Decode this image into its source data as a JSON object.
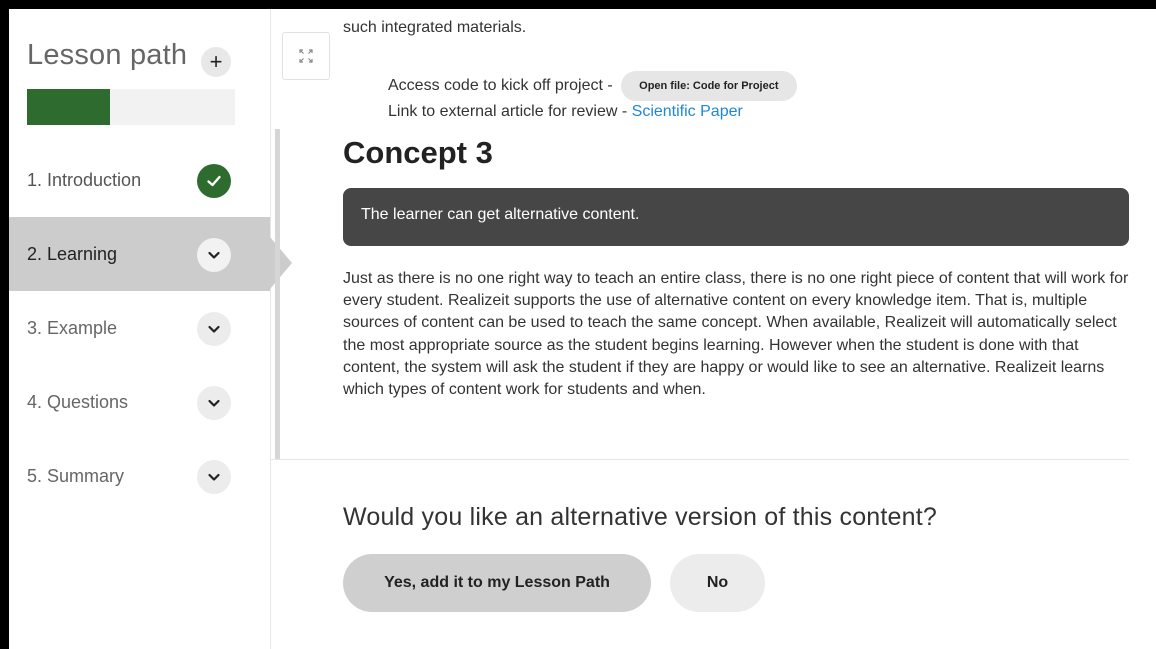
{
  "sidebar": {
    "title": "Lesson path",
    "add_label": "+",
    "progress_fraction": 0.4,
    "steps": [
      {
        "label": "1. Introduction",
        "state": "complete",
        "icon": "check-icon"
      },
      {
        "label": "2. Learning",
        "state": "active",
        "icon": "chevron-down-icon"
      },
      {
        "label": "3. Example",
        "state": "pending",
        "icon": "chevron-down-icon"
      },
      {
        "label": "4. Questions",
        "state": "pending",
        "icon": "chevron-down-icon"
      },
      {
        "label": "5. Summary",
        "state": "pending",
        "icon": "chevron-down-icon"
      }
    ]
  },
  "toolbar": {
    "expand_icon": "expand-icon"
  },
  "content": {
    "intro_text": "such integrated materials.",
    "access_code_text": "Access code to kick off project -",
    "open_file_label": "Open file: Code for Project",
    "article_text": "Link to external article for review -",
    "article_link": "Scientific Paper",
    "concept_title": "Concept 3",
    "objective": "The learner can get alternative content.",
    "body": "Just as there is no one right way to teach an entire class, there is no one right piece of content that will work for every student. Realizeit supports the use of alternative content on every knowledge item. That is, multiple sources of content can be used to teach the same concept. When available, Realizeit will automatically select the most appropriate source as the student begins learning. However when the student is done with that content, the system will ask the student if they are happy or would like to see an alternative. Realizeit learns which types of content work for students and when."
  },
  "prompt": {
    "question": "Would you like an alternative version of this content?",
    "yes_label": "Yes, add it to my Lesson Path",
    "no_label": "No"
  },
  "colors": {
    "accent_green": "#2e6b2e",
    "active_step": "#cccccc",
    "objective_bg": "#464646",
    "link": "#1e88d6"
  }
}
